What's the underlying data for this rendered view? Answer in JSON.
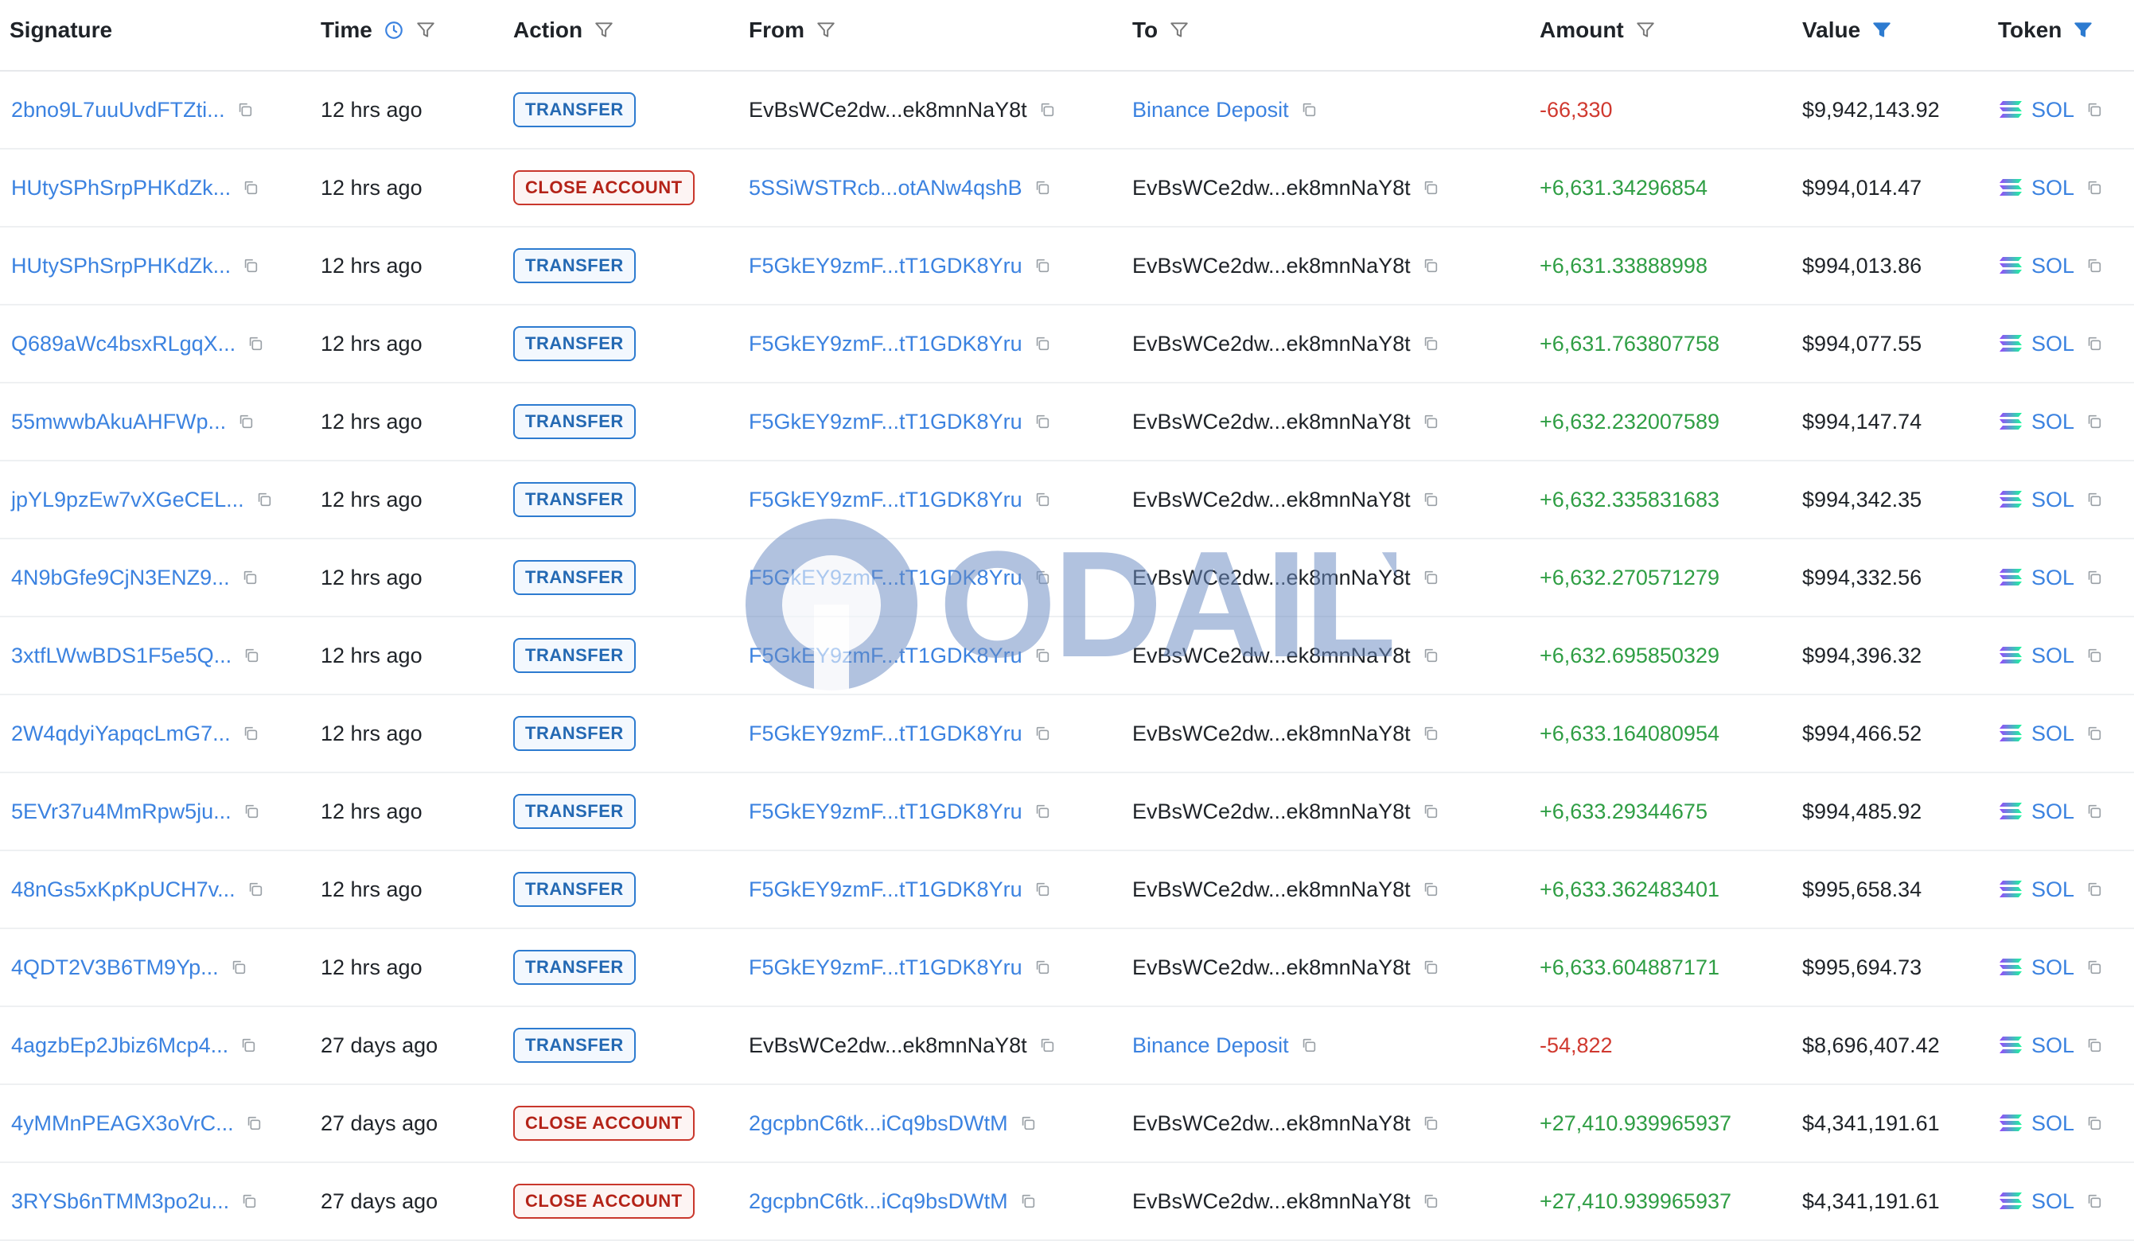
{
  "headers": {
    "signature": "Signature",
    "time": "Time",
    "action": "Action",
    "from": "From",
    "to": "To",
    "amount": "Amount",
    "value": "Value",
    "token": "Token"
  },
  "icons": {
    "filter": "filter-icon",
    "filter_active": "filter-active-icon",
    "clock": "clock-icon",
    "copy": "copy-icon",
    "sol_logo": "solana-logo-icon"
  },
  "colors": {
    "link": "#3b82e0",
    "negative": "#d0392f",
    "positive": "#2f9e44",
    "transfer_badge": "#2d7bd0",
    "close_badge": "#c9372c",
    "filter_active": "#2d7bd0"
  },
  "watermark": "ODAILY",
  "rows": [
    {
      "signature": "2bno9L7uuUvdFTZti...",
      "time": "12 hrs ago",
      "action": "TRANSFER",
      "action_type": "transfer",
      "from": "EvBsWCe2dw...ek8mnNaY8t",
      "from_link": false,
      "to": "Binance Deposit",
      "to_link": true,
      "amount": "-66,330",
      "amount_sign": "neg",
      "value": "$9,942,143.92",
      "token": "SOL"
    },
    {
      "signature": "HUtySPhSrpPHKdZk...",
      "time": "12 hrs ago",
      "action": "CLOSE ACCOUNT",
      "action_type": "close",
      "from": "5SSiWSTRcb...otANw4qshB",
      "from_link": true,
      "to": "EvBsWCe2dw...ek8mnNaY8t",
      "to_link": false,
      "amount": "+6,631.34296854",
      "amount_sign": "pos",
      "value": "$994,014.47",
      "token": "SOL"
    },
    {
      "signature": "HUtySPhSrpPHKdZk...",
      "time": "12 hrs ago",
      "action": "TRANSFER",
      "action_type": "transfer",
      "from": "F5GkEY9zmF...tT1GDK8Yru",
      "from_link": true,
      "to": "EvBsWCe2dw...ek8mnNaY8t",
      "to_link": false,
      "amount": "+6,631.33888998",
      "amount_sign": "pos",
      "value": "$994,013.86",
      "token": "SOL"
    },
    {
      "signature": "Q689aWc4bsxRLgqX...",
      "time": "12 hrs ago",
      "action": "TRANSFER",
      "action_type": "transfer",
      "from": "F5GkEY9zmF...tT1GDK8Yru",
      "from_link": true,
      "to": "EvBsWCe2dw...ek8mnNaY8t",
      "to_link": false,
      "amount": "+6,631.763807758",
      "amount_sign": "pos",
      "value": "$994,077.55",
      "token": "SOL"
    },
    {
      "signature": "55mwwbAkuAHFWp...",
      "time": "12 hrs ago",
      "action": "TRANSFER",
      "action_type": "transfer",
      "from": "F5GkEY9zmF...tT1GDK8Yru",
      "from_link": true,
      "to": "EvBsWCe2dw...ek8mnNaY8t",
      "to_link": false,
      "amount": "+6,632.232007589",
      "amount_sign": "pos",
      "value": "$994,147.74",
      "token": "SOL"
    },
    {
      "signature": "jpYL9pzEw7vXGeCEL...",
      "time": "12 hrs ago",
      "action": "TRANSFER",
      "action_type": "transfer",
      "from": "F5GkEY9zmF...tT1GDK8Yru",
      "from_link": true,
      "to": "EvBsWCe2dw...ek8mnNaY8t",
      "to_link": false,
      "amount": "+6,632.335831683",
      "amount_sign": "pos",
      "value": "$994,342.35",
      "token": "SOL"
    },
    {
      "signature": "4N9bGfe9CjN3ENZ9...",
      "time": "12 hrs ago",
      "action": "TRANSFER",
      "action_type": "transfer",
      "from": "F5GkEY9zmF...tT1GDK8Yru",
      "from_link": true,
      "to": "EvBsWCe2dw...ek8mnNaY8t",
      "to_link": false,
      "amount": "+6,632.270571279",
      "amount_sign": "pos",
      "value": "$994,332.56",
      "token": "SOL"
    },
    {
      "signature": "3xtfLWwBDS1F5e5Q...",
      "time": "12 hrs ago",
      "action": "TRANSFER",
      "action_type": "transfer",
      "from": "F5GkEY9zmF...tT1GDK8Yru",
      "from_link": true,
      "to": "EvBsWCe2dw...ek8mnNaY8t",
      "to_link": false,
      "amount": "+6,632.695850329",
      "amount_sign": "pos",
      "value": "$994,396.32",
      "token": "SOL"
    },
    {
      "signature": "2W4qdyiYapqcLmG7...",
      "time": "12 hrs ago",
      "action": "TRANSFER",
      "action_type": "transfer",
      "from": "F5GkEY9zmF...tT1GDK8Yru",
      "from_link": true,
      "to": "EvBsWCe2dw...ek8mnNaY8t",
      "to_link": false,
      "amount": "+6,633.164080954",
      "amount_sign": "pos",
      "value": "$994,466.52",
      "token": "SOL"
    },
    {
      "signature": "5EVr37u4MmRpw5ju...",
      "time": "12 hrs ago",
      "action": "TRANSFER",
      "action_type": "transfer",
      "from": "F5GkEY9zmF...tT1GDK8Yru",
      "from_link": true,
      "to": "EvBsWCe2dw...ek8mnNaY8t",
      "to_link": false,
      "amount": "+6,633.29344675",
      "amount_sign": "pos",
      "value": "$994,485.92",
      "token": "SOL"
    },
    {
      "signature": "48nGs5xKpKpUCH7v...",
      "time": "12 hrs ago",
      "action": "TRANSFER",
      "action_type": "transfer",
      "from": "F5GkEY9zmF...tT1GDK8Yru",
      "from_link": true,
      "to": "EvBsWCe2dw...ek8mnNaY8t",
      "to_link": false,
      "amount": "+6,633.362483401",
      "amount_sign": "pos",
      "value": "$995,658.34",
      "token": "SOL"
    },
    {
      "signature": "4QDT2V3B6TM9Yp...",
      "time": "12 hrs ago",
      "action": "TRANSFER",
      "action_type": "transfer",
      "from": "F5GkEY9zmF...tT1GDK8Yru",
      "from_link": true,
      "to": "EvBsWCe2dw...ek8mnNaY8t",
      "to_link": false,
      "amount": "+6,633.604887171",
      "amount_sign": "pos",
      "value": "$995,694.73",
      "token": "SOL"
    },
    {
      "signature": "4agzbEp2Jbiz6Mcp4...",
      "time": "27 days ago",
      "action": "TRANSFER",
      "action_type": "transfer",
      "from": "EvBsWCe2dw...ek8mnNaY8t",
      "from_link": false,
      "to": "Binance Deposit",
      "to_link": true,
      "amount": "-54,822",
      "amount_sign": "neg",
      "value": "$8,696,407.42",
      "token": "SOL"
    },
    {
      "signature": "4yMMnPEAGX3oVrC...",
      "time": "27 days ago",
      "action": "CLOSE ACCOUNT",
      "action_type": "close",
      "from": "2gcpbnC6tk...iCq9bsDWtM",
      "from_link": true,
      "to": "EvBsWCe2dw...ek8mnNaY8t",
      "to_link": false,
      "amount": "+27,410.939965937",
      "amount_sign": "pos",
      "value": "$4,341,191.61",
      "token": "SOL"
    },
    {
      "signature": "3RYSb6nTMM3po2u...",
      "time": "27 days ago",
      "action": "CLOSE ACCOUNT",
      "action_type": "close",
      "from": "2gcpbnC6tk...iCq9bsDWtM",
      "from_link": true,
      "to": "EvBsWCe2dw...ek8mnNaY8t",
      "to_link": false,
      "amount": "+27,410.939965937",
      "amount_sign": "pos",
      "value": "$4,341,191.61",
      "token": "SOL"
    }
  ]
}
